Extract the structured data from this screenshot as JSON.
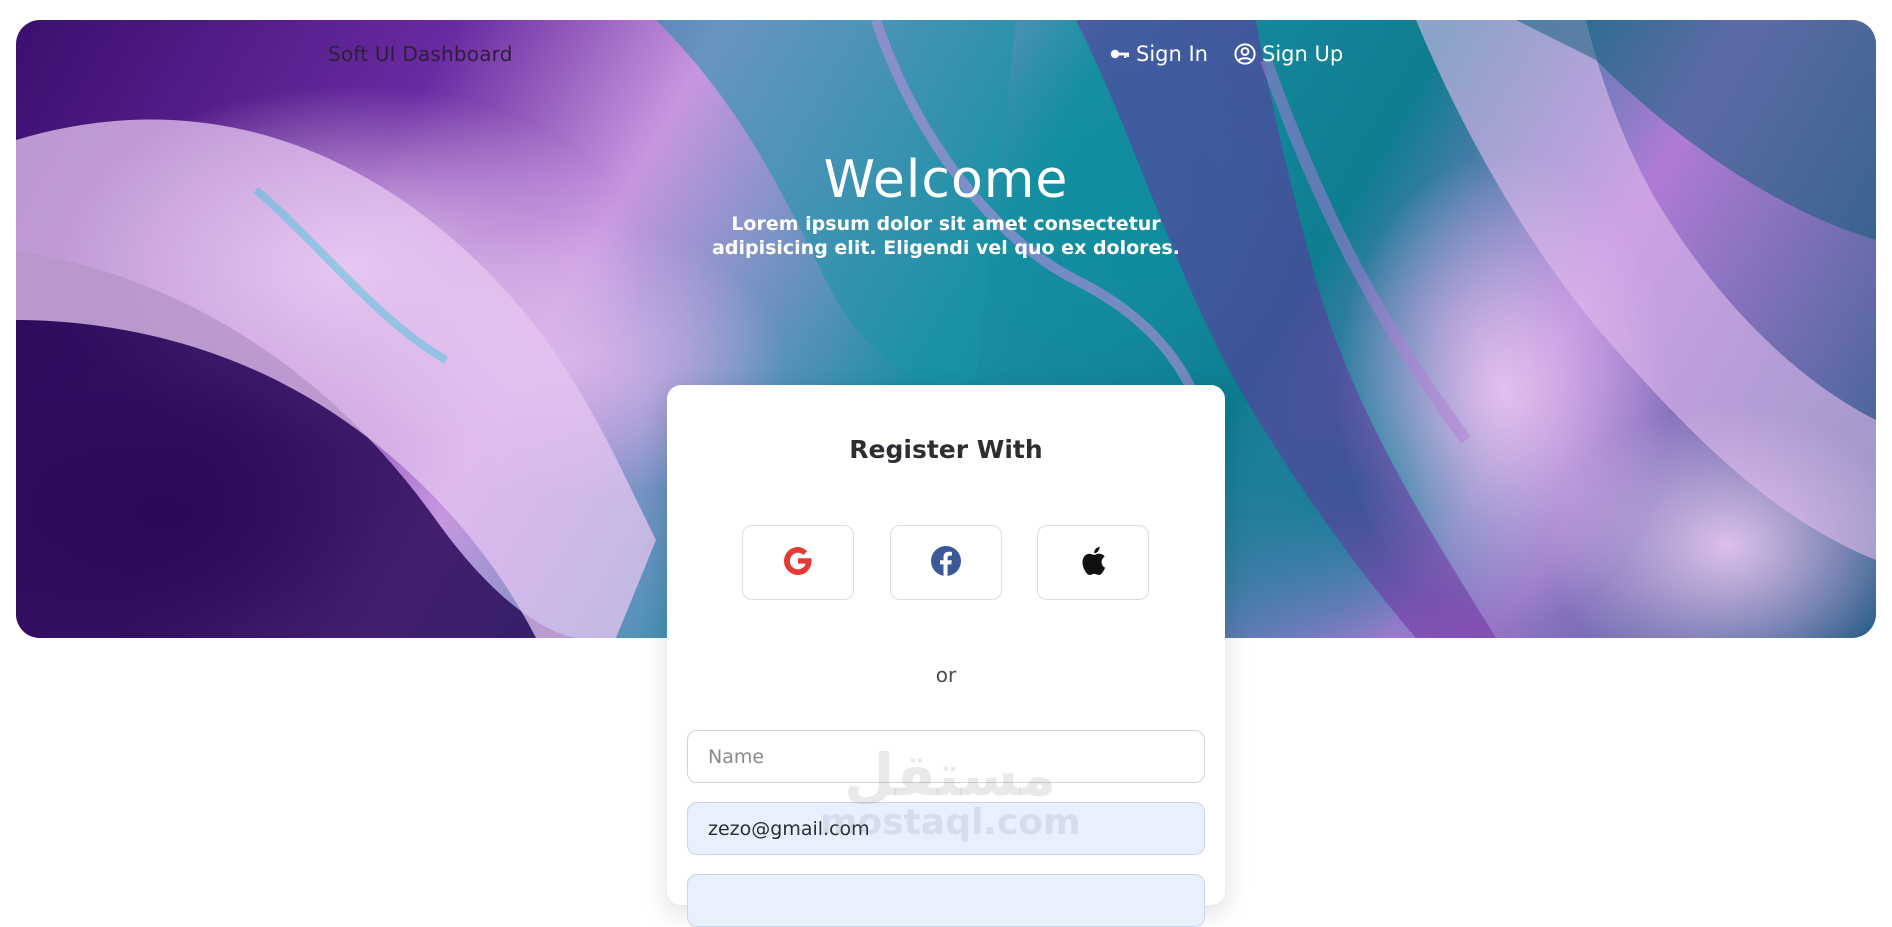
{
  "navbar": {
    "brand": "Soft UI Dashboard",
    "sign_in": "Sign In",
    "sign_up": "Sign Up",
    "icons": {
      "sign_in": "key-icon",
      "sign_up": "user-circle-icon"
    }
  },
  "hero": {
    "title": "Welcome",
    "subtitle": "Lorem ipsum dolor sit amet consectetur adipisicing elit. Eligendi vel quo ex dolores."
  },
  "card": {
    "title": "Register With",
    "social": [
      {
        "name": "google",
        "icon": "google-icon",
        "color": "#ea4335"
      },
      {
        "name": "facebook",
        "icon": "facebook-icon",
        "color": "#3b5998"
      },
      {
        "name": "apple",
        "icon": "apple-icon",
        "color": "#111111"
      }
    ],
    "divider": "or",
    "fields": {
      "name_placeholder": "Name",
      "name_value": "",
      "email_value": "zezo@gmail.com",
      "password_value": ""
    }
  },
  "watermark": {
    "arabic": "مستقل",
    "latin": "mostaql.com"
  },
  "colors": {
    "card_bg": "#ffffff",
    "autofill_bg": "#e8f0fe"
  }
}
